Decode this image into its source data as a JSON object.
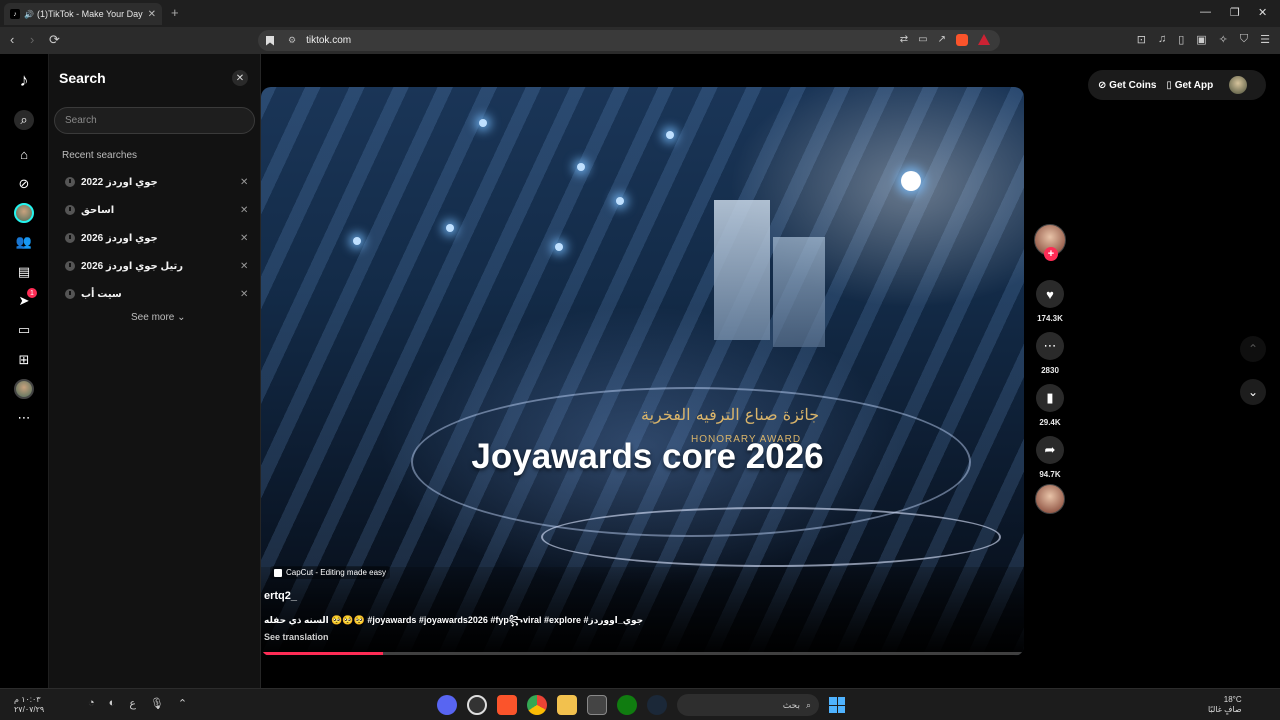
{
  "browser": {
    "tab_title": "(1)TikTok - Make Your Day",
    "url": "tiktok.com"
  },
  "rail": {
    "inbox_badge": "1"
  },
  "search_panel": {
    "title": "Search",
    "placeholder": "Search",
    "recent_label": "Recent searches",
    "recent": [
      "جوي اوردز 2022",
      "اساحق",
      "جوي اوردز 2026",
      "رتيل جوي اوردز 2026",
      "سيت أب"
    ],
    "see_more": "See more"
  },
  "video": {
    "overlay_title": "Joyawards core 2026",
    "stage_arabic_title": "جائزة صناع الترفيه الفخرية",
    "stage_english_title": "HONORARY AWARD",
    "capcut_label": "CapCut - Editing made easy",
    "username": "ertq2_",
    "caption": "السنه ذي حفله 🥺🥺🥺 #joyawards #joyawards2026 #fyp꧂viral #explore #جوي_اووردز",
    "see_translation": "See translation",
    "progress": 0.16
  },
  "actions": {
    "likes": "174.3K",
    "comments": "2830",
    "saves": "29.4K",
    "shares": "94.7K"
  },
  "header": {
    "get_coins": "Get Coins",
    "get_app": "Get App"
  },
  "taskbar": {
    "time": "١٠:٠٣ م",
    "date": "٢٧/٠٧/٢٩",
    "lang": "ع",
    "search_placeholder": "بحث",
    "weather_temp": "18°C",
    "weather_desc": "صافٍ غالبًا"
  },
  "colors": {
    "accent": "#fe2c55",
    "cyan": "#25f4ee",
    "panel": "#121212"
  }
}
